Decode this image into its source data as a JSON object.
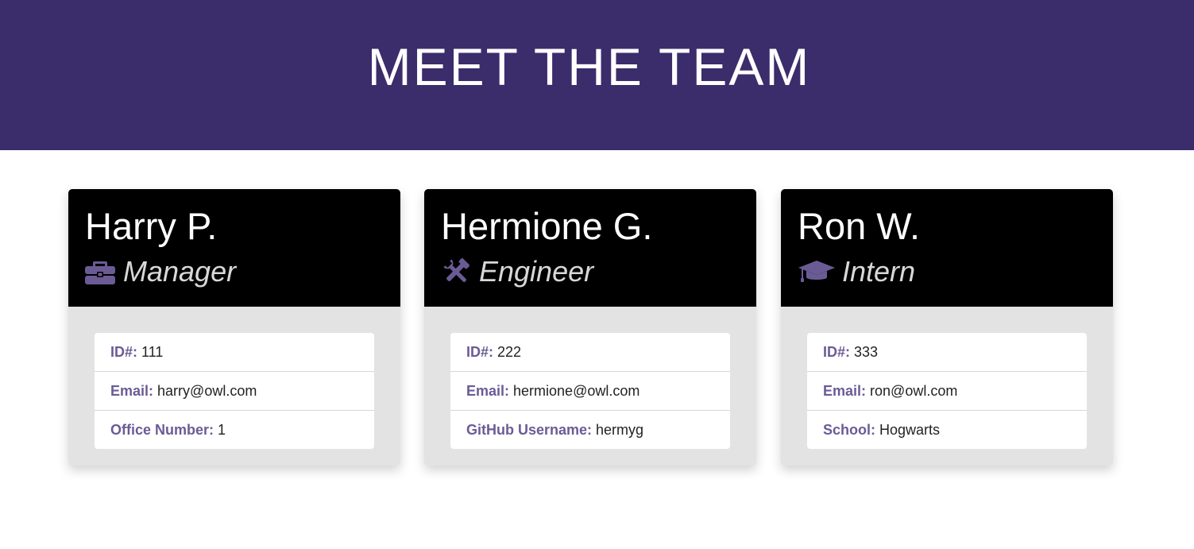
{
  "header": {
    "title": "MEET THE TEAM"
  },
  "colors": {
    "banner": "#3b2c6b",
    "accent": "#6b5b95",
    "card_header": "#000000",
    "card_body": "#e3e3e3"
  },
  "cards": [
    {
      "name": "Harry P.",
      "role": "Manager",
      "icon": "briefcase-icon",
      "items": [
        {
          "label": "ID#:",
          "value": "111"
        },
        {
          "label": "Email:",
          "value": "harry@owl.com"
        },
        {
          "label": "Office Number:",
          "value": "1"
        }
      ]
    },
    {
      "name": "Hermione G.",
      "role": "Engineer",
      "icon": "tools-icon",
      "items": [
        {
          "label": "ID#:",
          "value": "222"
        },
        {
          "label": "Email:",
          "value": "hermione@owl.com"
        },
        {
          "label": "GitHub Username:",
          "value": "hermyg"
        }
      ]
    },
    {
      "name": "Ron W.",
      "role": "Intern",
      "icon": "graduation-cap-icon",
      "items": [
        {
          "label": "ID#:",
          "value": "333"
        },
        {
          "label": "Email:",
          "value": "ron@owl.com"
        },
        {
          "label": "School:",
          "value": "Hogwarts"
        }
      ]
    }
  ]
}
